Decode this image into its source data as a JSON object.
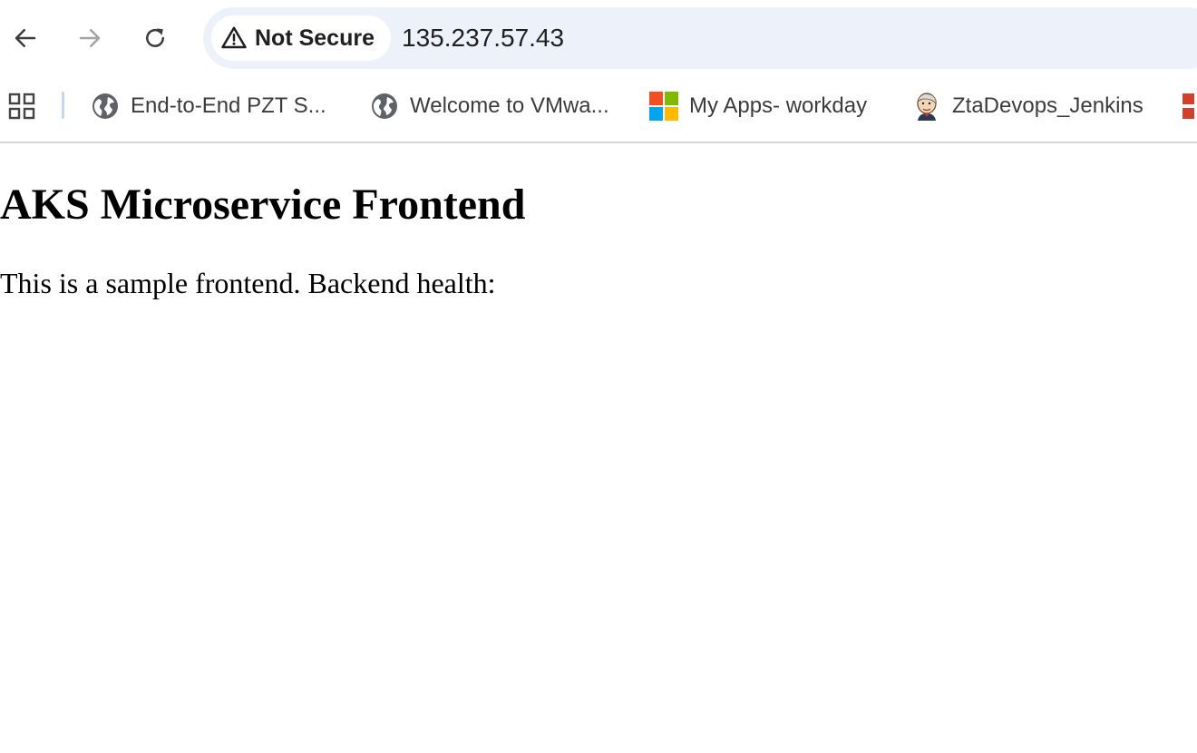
{
  "toolbar": {
    "back_icon": "arrow-left-icon",
    "forward_icon": "arrow-right-icon",
    "reload_icon": "reload-icon",
    "security_label": "Not Secure",
    "security_icon": "warning-triangle-icon",
    "url": "135.237.57.43"
  },
  "bookmarks": {
    "apps_icon": "apps-grid-icon",
    "items": [
      {
        "label": "End-to-End PZT S...",
        "icon": "globe-icon"
      },
      {
        "label": "Welcome to VMwa...",
        "icon": "globe-icon"
      },
      {
        "label": "My Apps- workday",
        "icon": "microsoft-logo-icon"
      },
      {
        "label": "ZtaDevops_Jenkins",
        "icon": "jenkins-icon"
      },
      {
        "label": "",
        "icon": "red-app-icon"
      }
    ]
  },
  "page": {
    "title": "AKS Microservice Frontend",
    "text": "This is a sample frontend. Backend health:"
  },
  "colors": {
    "omnibox_bg": "#edf2fa",
    "divider": "#c8d7f0",
    "ms_red": "#f25022",
    "ms_green": "#7fba00",
    "ms_blue": "#00a4ef",
    "ms_yellow": "#ffb900"
  }
}
